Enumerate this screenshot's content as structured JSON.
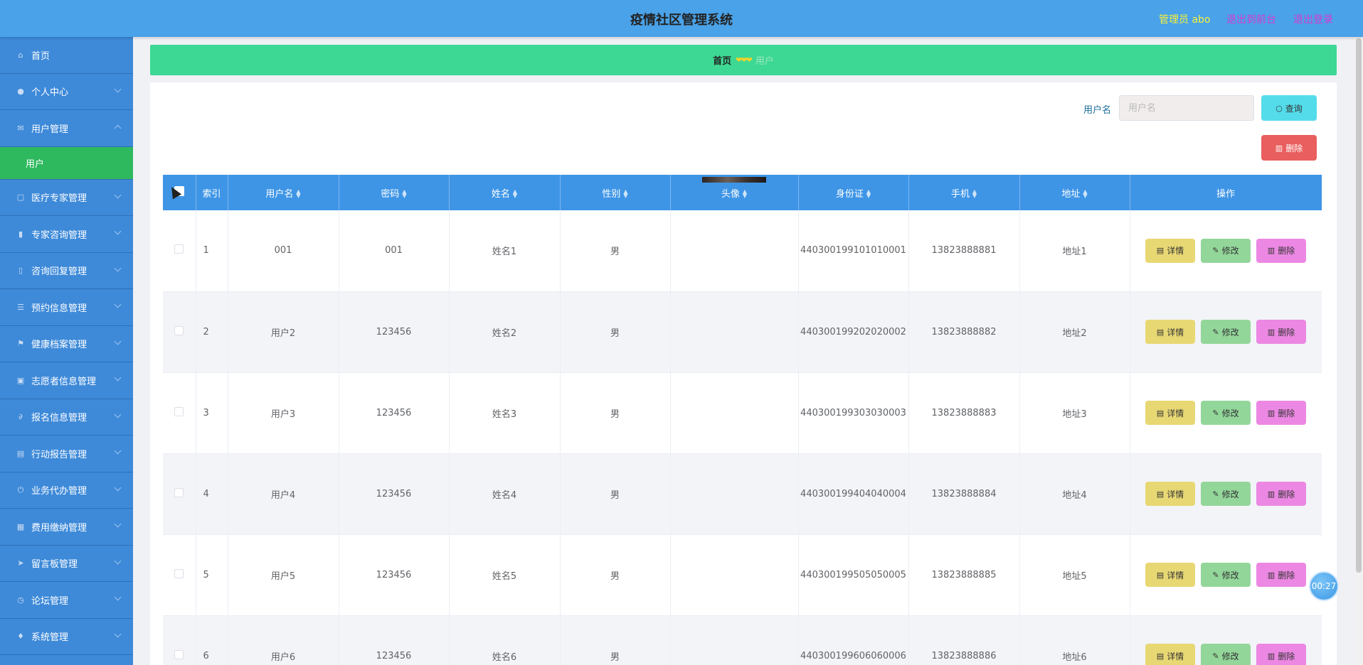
{
  "header": {
    "title": "疫情社区管理系统",
    "admin": "管理员 abo",
    "back_to_front": "退出到前台",
    "logout": "退出登录"
  },
  "sidebar": {
    "items": [
      {
        "label": "首页",
        "icon": "home-icon"
      },
      {
        "label": "个人中心",
        "icon": "user-icon"
      },
      {
        "label": "用户管理",
        "icon": "mail-icon"
      },
      {
        "label": "医疗专家管理",
        "icon": "document-icon"
      },
      {
        "label": "专家咨询管理",
        "icon": "bar-chart-icon"
      },
      {
        "label": "咨询回复管理",
        "icon": "phone-icon"
      },
      {
        "label": "预约信息管理",
        "icon": "sliders-icon"
      },
      {
        "label": "健康档案管理",
        "icon": "flag-icon"
      },
      {
        "label": "志愿者信息管理",
        "icon": "clipboard-icon"
      },
      {
        "label": "报名信息管理",
        "icon": "attachment-icon"
      },
      {
        "label": "行动报告管理",
        "icon": "printer-icon"
      },
      {
        "label": "业务代办管理",
        "icon": "power-icon"
      },
      {
        "label": "费用缴纳管理",
        "icon": "briefcase-icon"
      },
      {
        "label": "留言板管理",
        "icon": "send-icon"
      },
      {
        "label": "论坛管理",
        "icon": "clock-icon"
      },
      {
        "label": "系统管理",
        "icon": "microphone-icon"
      }
    ],
    "sub_item": "用户"
  },
  "breadcrumb": {
    "home": "首页",
    "separator": "❤❤❤",
    "current": "用户"
  },
  "search": {
    "label": "用户名",
    "placeholder": "用户名",
    "query_button": "查询",
    "delete_button": "删除"
  },
  "table": {
    "columns": [
      "索引",
      "用户名",
      "密码",
      "姓名",
      "性别",
      "头像",
      "身份证",
      "手机",
      "地址",
      "操作"
    ],
    "rows": [
      {
        "index": "1",
        "username": "001",
        "password": "001",
        "name": "姓名1",
        "gender": "男",
        "id_card": "440300199101010001",
        "phone": "13823888881",
        "address": "地址1"
      },
      {
        "index": "2",
        "username": "用户2",
        "password": "123456",
        "name": "姓名2",
        "gender": "男",
        "id_card": "440300199202020002",
        "phone": "13823888882",
        "address": "地址2"
      },
      {
        "index": "3",
        "username": "用户3",
        "password": "123456",
        "name": "姓名3",
        "gender": "男",
        "id_card": "440300199303030003",
        "phone": "13823888883",
        "address": "地址3"
      },
      {
        "index": "4",
        "username": "用户4",
        "password": "123456",
        "name": "姓名4",
        "gender": "男",
        "id_card": "440300199404040004",
        "phone": "13823888884",
        "address": "地址4"
      },
      {
        "index": "5",
        "username": "用户5",
        "password": "123456",
        "name": "姓名5",
        "gender": "男",
        "id_card": "440300199505050005",
        "phone": "13823888885",
        "address": "地址5"
      },
      {
        "index": "6",
        "username": "用户6",
        "password": "123456",
        "name": "姓名6",
        "gender": "男",
        "id_card": "440300199606060006",
        "phone": "13823888886",
        "address": "地址6"
      }
    ],
    "actions": {
      "detail": "详情",
      "edit": "修改",
      "delete": "删除"
    }
  },
  "timer": "00:27",
  "colors": {
    "header_bg": "#4aa2e8",
    "sidebar_bg": "#3e8ad9",
    "active_sub": "#2eb95f",
    "breadcrumb_bg": "#3dd893",
    "table_header": "#3e95e6"
  }
}
